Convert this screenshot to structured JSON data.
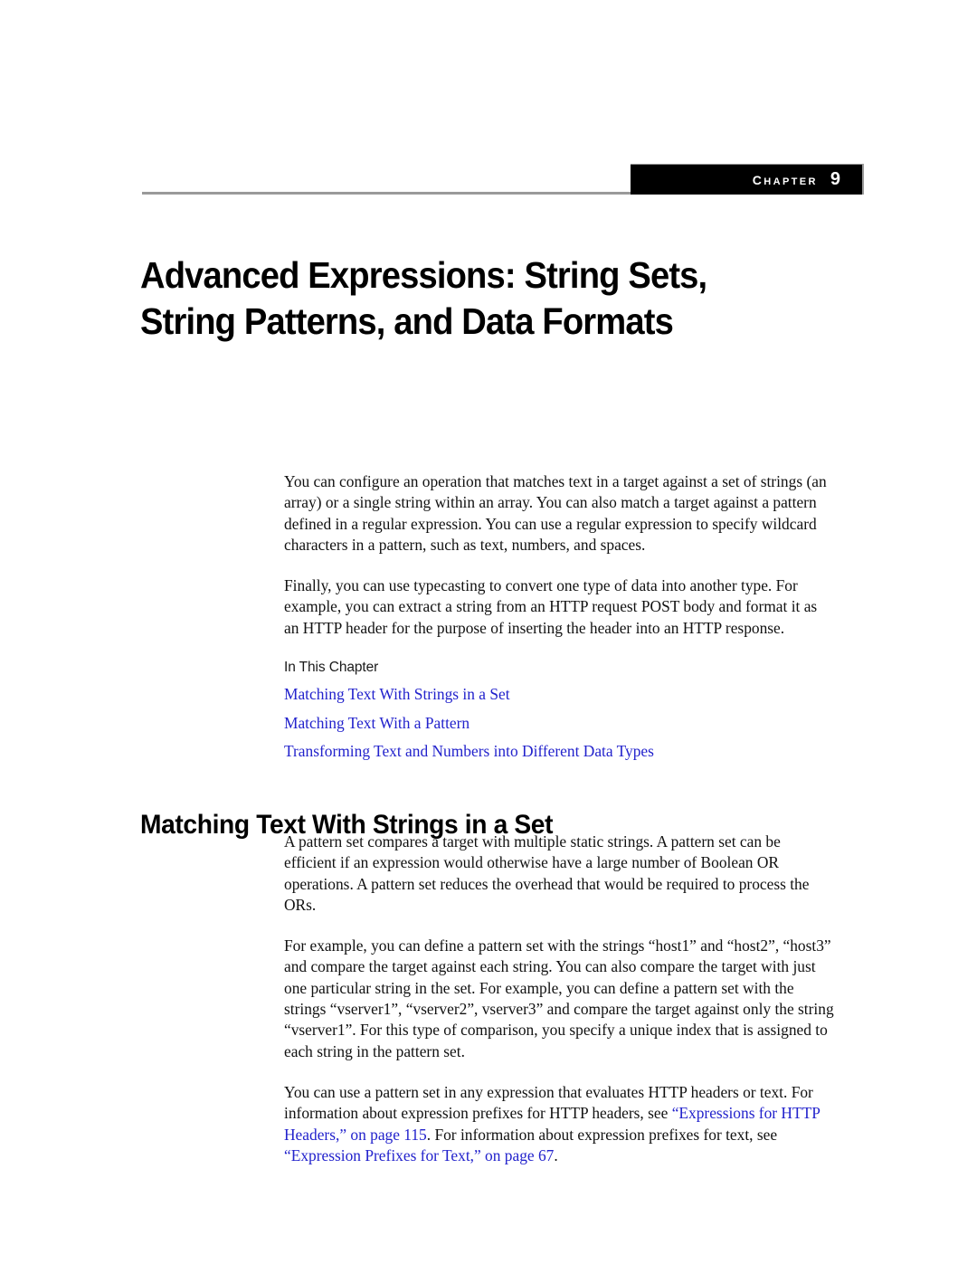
{
  "header": {
    "chapter_word": "Chapter",
    "chapter_number": "9"
  },
  "title": {
    "line1": "Advanced Expressions: String Sets,",
    "line2": "String Patterns, and Data Formats"
  },
  "intro": {
    "paragraph1": "You can configure an operation that matches text in a target against a set of strings (an array) or a single string within an array. You can also match a target against a pattern defined in a regular expression. You can use a regular expression to specify wildcard characters in a pattern, such as text, numbers, and spaces.",
    "paragraph2": "Finally, you can use typecasting to convert one type of data into another type. For example, you can extract a string from an HTTP request POST body and format it as an HTTP header for the purpose of inserting the header into an HTTP response."
  },
  "in_this_chapter": {
    "label": "In This Chapter",
    "links": [
      "Matching Text With Strings in a Set",
      "Matching Text With a Pattern",
      "Transforming Text and Numbers into Different Data Types"
    ]
  },
  "section": {
    "heading": "Matching Text With Strings in a Set",
    "paragraph1": "A pattern set compares a target with multiple static strings. A pattern set can be efficient if an expression would otherwise have a large number of Boolean OR operations. A pattern set reduces the overhead that would be required to process the ORs.",
    "paragraph2": "For example, you can define a pattern set with the strings “host1” and “host2”, “host3” and compare the target against each string. You can also compare the target with just one particular string in the set. For example, you can define a pattern set with the strings “vserver1”, “vserver2”, vserver3” and compare the target against only the string “vserver1”. For this type of comparison, you specify a unique index that is assigned to each string in the pattern set.",
    "paragraph3": {
      "text_before_link1": "You can use a pattern set in any expression that evaluates HTTP headers or text. For information about expression prefixes for HTTP headers, see ",
      "link1": "“Expressions for HTTP Headers,” on page 115",
      "text_between": ". For information about expression prefixes for text, see ",
      "link2": "“Expression Prefixes for Text,” on page 67",
      "text_after": "."
    }
  },
  "colors": {
    "link_blue": "#2222cc",
    "banner_black": "#000000",
    "rule_gray": "#9a9a9a"
  }
}
